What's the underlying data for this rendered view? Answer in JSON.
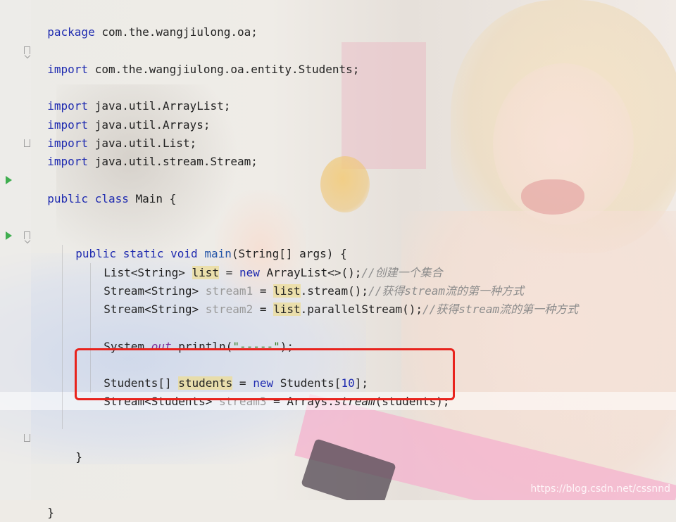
{
  "code": {
    "line_package": [
      "package",
      " com.the.wangjiulong.oa;"
    ],
    "line_import_students": [
      "import",
      " com.the.wangjiulong.oa.entity.Students;"
    ],
    "line_import_arraylist": [
      "import",
      " java.util.ArrayList;"
    ],
    "line_import_arrays": [
      "import",
      " java.util.Arrays;"
    ],
    "line_import_list": [
      "import",
      " java.util.List;"
    ],
    "line_import_stream": [
      "import",
      " java.util.stream.Stream;"
    ],
    "class_decl": {
      "kw1": "public",
      "kw2": "class",
      "rest": " Main {"
    },
    "main_decl": {
      "kw1": "public",
      "kw2": "static",
      "kw3": "void",
      "name": "main",
      "rest": "(String[] args) {"
    },
    "list_line": {
      "type": "List<String> ",
      "var": "list",
      "eq": " = ",
      "kw": "new",
      "rest": " ArrayList<>();",
      "comment": "//创建一个集合"
    },
    "stream1_line": {
      "type": "Stream<String> ",
      "var": "stream1",
      "eq": " = ",
      "ref": "list",
      "rest": ".stream();",
      "comment": "//获得stream流的第一种方式"
    },
    "stream2_line": {
      "type": "Stream<String> ",
      "var": "stream2",
      "eq": " = ",
      "ref": "list",
      "rest": ".parallelStream();",
      "comment": "//获得stream流的第一种方式"
    },
    "println_line": {
      "pre": "System.",
      "field": "out",
      "mid": ".println(",
      "str": "\"-----\"",
      "end": ");"
    },
    "students_line": {
      "type": "Students[] ",
      "var": "students",
      "eq": " = ",
      "kw": "new",
      "mid": " Students[",
      "num": "10",
      "end": "];"
    },
    "stream3_line": {
      "type": "Stream<Students> ",
      "var": "stream3",
      "eq": " = Arrays.",
      "method": "stream",
      "end": "(students);"
    },
    "close_method": "}",
    "close_class": "}"
  },
  "watermark": "https://blog.csdn.net/cssnnd",
  "colors": {
    "highlight_box": "#e8231d",
    "keyword": "#1f2bb0",
    "string": "#3a7d27",
    "comment": "#8c8c8c"
  }
}
